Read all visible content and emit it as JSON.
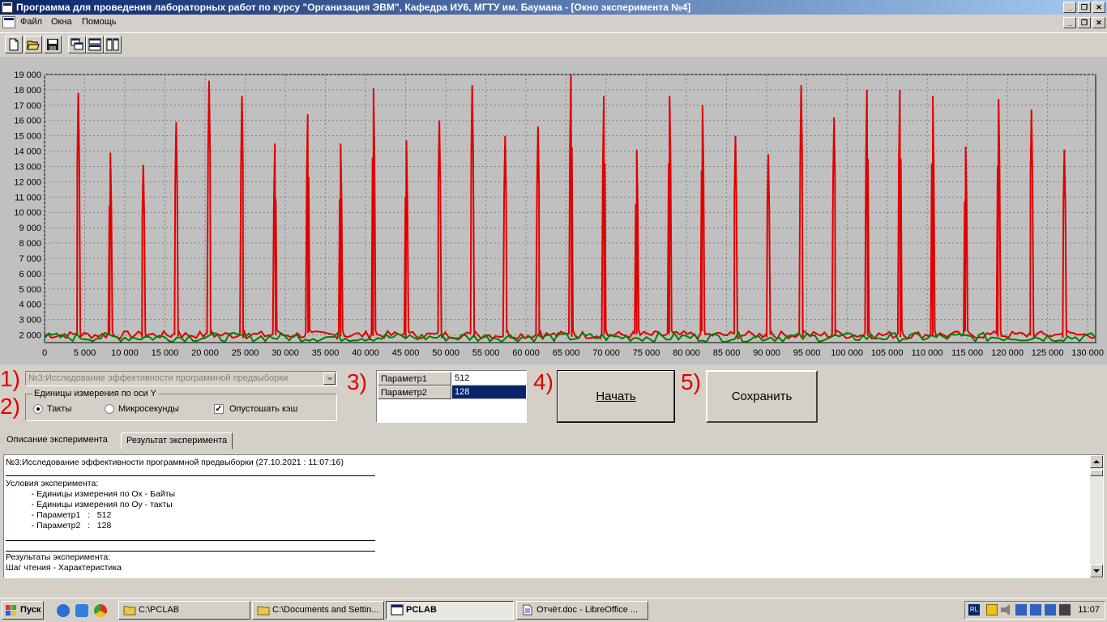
{
  "window": {
    "title": "Программа для проведения лабораторных работ по курсу \"Организация ЭВМ\", Кафедра ИУ6, МГТУ им. Баумана - [Окно эксперимента №4]",
    "btn_minimize": "_",
    "btn_restore": "❐",
    "btn_close": "✕"
  },
  "menu": {
    "items": [
      "Файл",
      "Окна",
      "Помощь"
    ]
  },
  "toolbar": {
    "buttons": [
      "new-icon",
      "open-icon",
      "save-icon",
      "cascade-icon",
      "tile-horizontal-icon",
      "tile-vertical-icon"
    ]
  },
  "chart_data": {
    "type": "line",
    "xlabel": "",
    "ylabel": "",
    "xlim": [
      0,
      131000
    ],
    "ylim": [
      1500,
      19000
    ],
    "xticks": [
      "0",
      "5 000",
      "10 000",
      "15 000",
      "20 000",
      "25 000",
      "30 000",
      "35 000",
      "40 000",
      "45 000",
      "50 000",
      "55 000",
      "60 000",
      "65 000",
      "70 000",
      "75 000",
      "80 000",
      "85 000",
      "90 000",
      "95 000",
      "100 000",
      "105 000",
      "110 000",
      "115 000",
      "120 000",
      "125 000",
      "130 000"
    ],
    "yticks": [
      "2 000",
      "3 000",
      "4 000",
      "5 000",
      "6 000",
      "7 000",
      "8 000",
      "9 000",
      "10 000",
      "11 000",
      "12 000",
      "13 000",
      "14 000",
      "15 000",
      "16 000",
      "17 000",
      "18 000",
      "19 000"
    ],
    "grid": true,
    "series": [
      {
        "color": "#e00000",
        "baseline": 2000,
        "peaks": [
          {
            "x": 4200,
            "y": 17800
          },
          {
            "x": 8200,
            "y": 13900
          },
          {
            "x": 12300,
            "y": 13100
          },
          {
            "x": 16400,
            "y": 15900
          },
          {
            "x": 20500,
            "y": 18600
          },
          {
            "x": 24600,
            "y": 17600
          },
          {
            "x": 28700,
            "y": 14500
          },
          {
            "x": 32800,
            "y": 16400
          },
          {
            "x": 36900,
            "y": 14500
          },
          {
            "x": 41000,
            "y": 18100
          },
          {
            "x": 45100,
            "y": 14700
          },
          {
            "x": 49200,
            "y": 16000
          },
          {
            "x": 53300,
            "y": 18300
          },
          {
            "x": 57400,
            "y": 15000
          },
          {
            "x": 61500,
            "y": 15600
          },
          {
            "x": 65600,
            "y": 19000
          },
          {
            "x": 69700,
            "y": 17600
          },
          {
            "x": 73800,
            "y": 14100
          },
          {
            "x": 77900,
            "y": 17600
          },
          {
            "x": 82000,
            "y": 17000
          },
          {
            "x": 86100,
            "y": 15000
          },
          {
            "x": 90200,
            "y": 13800
          },
          {
            "x": 94300,
            "y": 18300
          },
          {
            "x": 98400,
            "y": 16200
          },
          {
            "x": 102500,
            "y": 18000
          },
          {
            "x": 106600,
            "y": 18000
          },
          {
            "x": 110700,
            "y": 17600
          },
          {
            "x": 114800,
            "y": 14300
          },
          {
            "x": 118900,
            "y": 17400
          },
          {
            "x": 123000,
            "y": 16700
          },
          {
            "x": 127100,
            "y": 14100
          }
        ]
      },
      {
        "color": "#008000",
        "baseline": 1850
      }
    ]
  },
  "controls": {
    "label_1": "1)",
    "label_2": "2)",
    "label_3": "3)",
    "label_4": "4)",
    "label_5": "5)",
    "experiment_combo": "№3:Исследование эффективности программной предвыборки",
    "units_group": "Единицы измерения по оси Y",
    "opt_ticks": "Такты",
    "opt_micro": "Микросекунды",
    "flush_cache": "Опустошать кэш",
    "check_mark": "✓",
    "params": [
      {
        "name": "Параметр1",
        "value": "512"
      },
      {
        "name": "Параметр2",
        "value": "128"
      }
    ],
    "start_btn": "Начать",
    "save_btn": "Сохранить"
  },
  "tabs": [
    "Описание эксперимента",
    "Результат эксперимента"
  ],
  "report": {
    "heading": "№3:Исследование эффективности программной предвыборки (27.10.2021 : 11:07:16)",
    "conditions_title": "Условия эксперимента:",
    "cond_1": "    - Единицы измерения по Ox - Байты",
    "cond_2": "    - Единицы измерения по Oy - такты",
    "cond_3": "    - Параметр1   :   512",
    "cond_4": "    - Параметр2   :   128",
    "results_title": "Результаты эксперимента:",
    "results_line": "Шаг чтения - Характеристика"
  },
  "taskbar": {
    "start": "Пуск",
    "tasks": [
      "C:\\PCLAB",
      "C:\\Documents and Settin...",
      "PCLAB",
      "Отчёт.doc - LibreOffice ..."
    ],
    "lang": "RL",
    "clock": "11:07"
  }
}
